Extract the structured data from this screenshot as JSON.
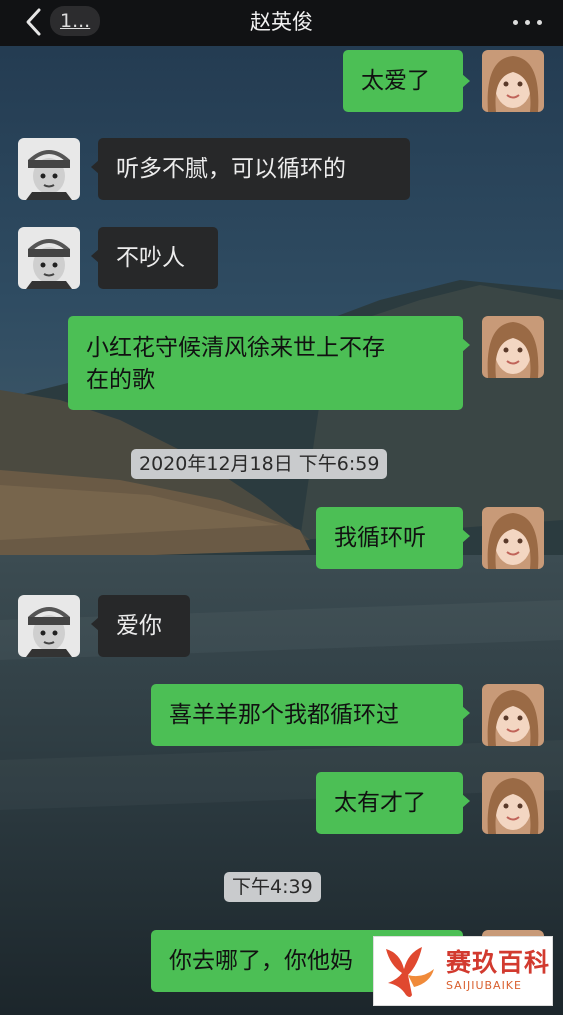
{
  "header": {
    "back_count": "1...",
    "title": "赵英俊"
  },
  "messages": [
    {
      "side": "right",
      "text": "太爱了"
    },
    {
      "side": "left",
      "text": "听多不腻，可以循环的"
    },
    {
      "side": "left",
      "text": "不吵人"
    },
    {
      "side": "right",
      "text_line1": "小红花守候清风徐来世上不存",
      "text_line2": "在的歌"
    },
    {
      "type": "timestamp",
      "text": "2020年12月18日 下午6:59"
    },
    {
      "side": "right",
      "text": "我循环听"
    },
    {
      "side": "left",
      "text": "爱你"
    },
    {
      "side": "right",
      "text": "喜羊羊那个我都循环过"
    },
    {
      "side": "right",
      "text": "太有才了"
    },
    {
      "type": "timestamp",
      "text": "下午4:39"
    },
    {
      "side": "right",
      "text": "你去哪了，你他妈"
    }
  ],
  "watermark": {
    "text": "赛玖百科",
    "subtext": "SAIJIUBAIKE",
    "color": "#d23a2f"
  },
  "colors": {
    "bubble_sent": "#4cbf55",
    "bubble_received": "#272829",
    "header_bg": "#111214",
    "timestamp_bg": "#c9cbcd"
  }
}
